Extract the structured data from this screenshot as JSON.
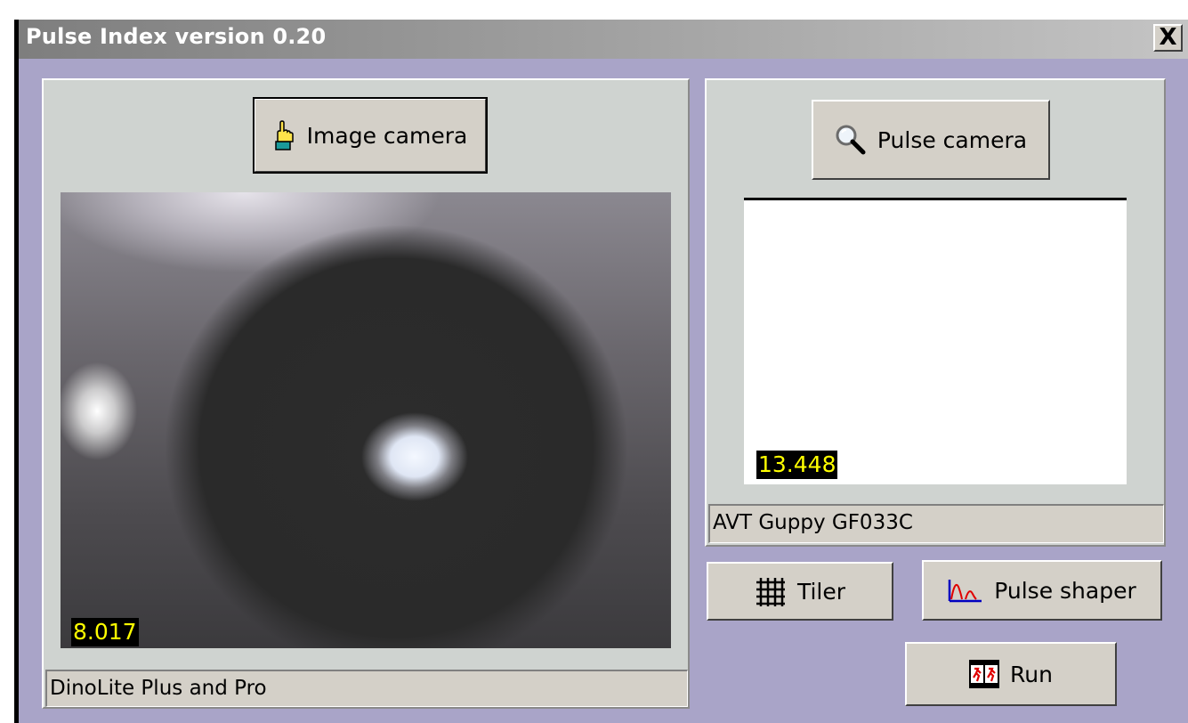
{
  "window": {
    "title": "Pulse Index version 0.20",
    "close_label": "X"
  },
  "image_panel": {
    "button_label": "Image camera",
    "button_icon": "pointing-hand-icon",
    "readout": "8.017",
    "device": "DinoLite Plus and Pro"
  },
  "pulse_panel": {
    "button_label": "Pulse camera",
    "button_icon": "magnifier-icon",
    "readout": "13.448",
    "device": "AVT Guppy GF033C"
  },
  "actions": {
    "tiler_label": "Tiler",
    "pulse_shaper_label": "Pulse shaper",
    "run_label": "Run"
  },
  "colors": {
    "window_bg": "#a9a4c8",
    "readout_bg": "#000000",
    "readout_fg": "#ffff00"
  }
}
